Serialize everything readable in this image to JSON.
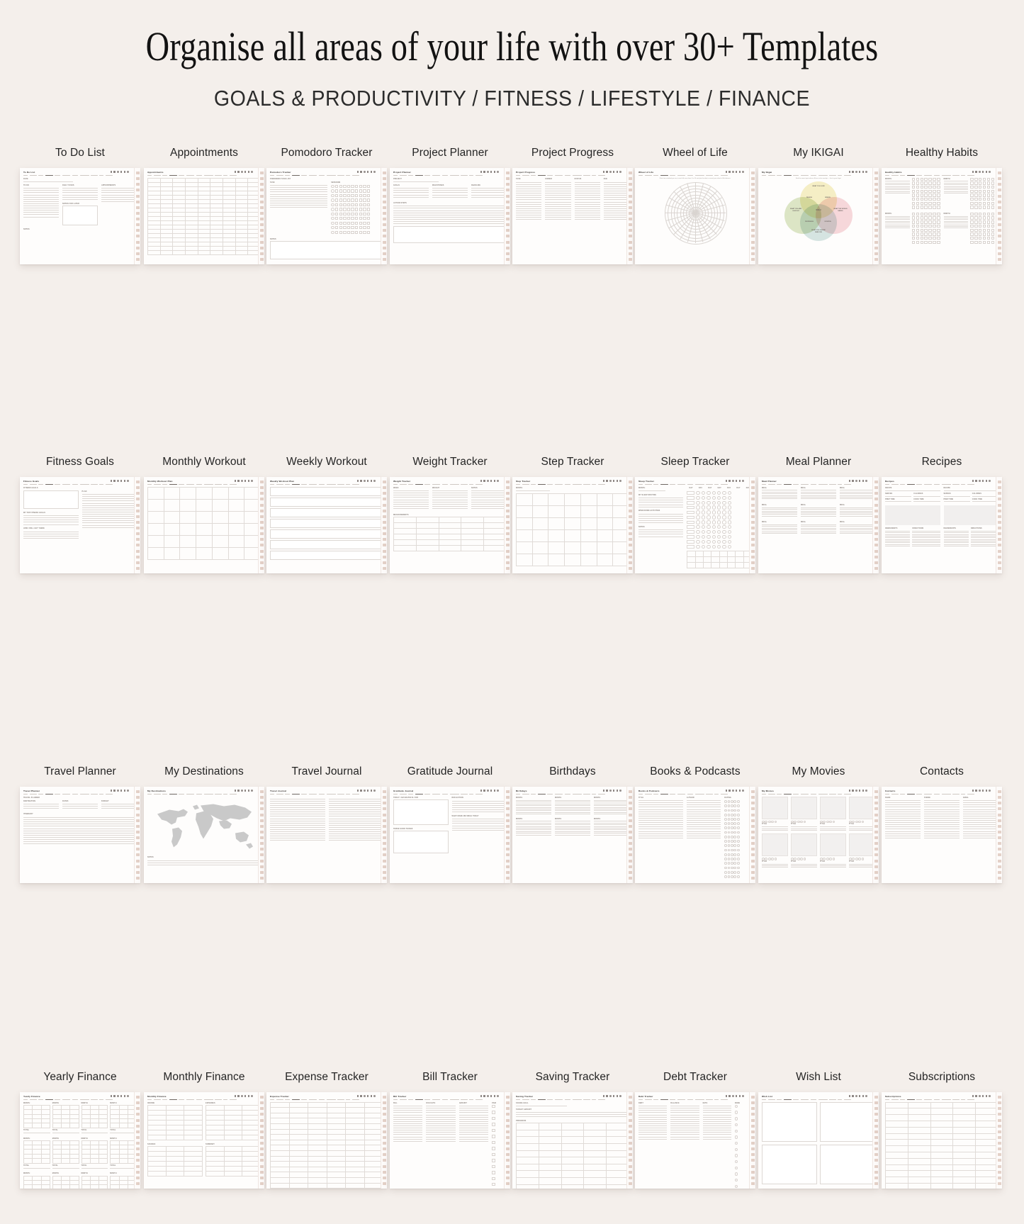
{
  "header": {
    "title": "Organise all areas of your life with over 30+ Templates",
    "subtitle": "GOALS & PRODUCTIVITY  /  FITNESS  /  LIFESTYLE  /  FINANCE"
  },
  "theme": {
    "background": "#f4efeb",
    "page": "#fefdfc",
    "rule": "#ddd8d4",
    "tab_marker": "#e3cfc5",
    "text": "#242424",
    "ikigai_top": "#f6f0c8",
    "ikigai_right": "#f7d9dd",
    "ikigai_bottom": "#d6e6e4",
    "ikigai_left": "#dde7c8",
    "map_land": "#c9c9c9"
  },
  "rows": [
    {
      "category": "GOALS & PRODUCTIVITY",
      "cards": [
        {
          "label": "To Do List",
          "page_title": "To Do List",
          "kind": "todo"
        },
        {
          "label": "Appointments",
          "page_title": "Appointments",
          "kind": "appointments"
        },
        {
          "label": "Pomodoro Tracker",
          "page_title": "Pomodoro Tracker",
          "kind": "pomodoro"
        },
        {
          "label": "Project Planner",
          "page_title": "Project Planner",
          "kind": "project-planner"
        },
        {
          "label": "Project Progress",
          "page_title": "Project Progress",
          "kind": "project-progress"
        },
        {
          "label": "Wheel of Life",
          "page_title": "Wheel of Life",
          "kind": "wheel",
          "note": "Rate how satisfied you are in each life area from 1 to 10 and join the dots to reveal your wheel of life balance."
        },
        {
          "label": "My IKIGAI",
          "page_title": "My Ikigai",
          "kind": "ikigai",
          "note": "Find the sweet spot where all four circles overlap — that is your ikigai.",
          "circles": [
            {
              "name": "WHAT YOU LOVE",
              "position": "top"
            },
            {
              "name": "WHAT THE WORLD NEEDS",
              "position": "right"
            },
            {
              "name": "WHAT YOU CAN BE PAID FOR",
              "position": "bottom"
            },
            {
              "name": "WHAT YOU ARE GOOD AT",
              "position": "left"
            }
          ],
          "center": "IKIGAI",
          "overlaps": [
            "PASSION",
            "MISSION",
            "PROFESSION",
            "VOCATION"
          ]
        },
        {
          "label": "Healthy Habits",
          "page_title": "Healthy Habits",
          "kind": "habits"
        }
      ]
    },
    {
      "category": "FITNESS",
      "cards": [
        {
          "label": "Fitness Goals",
          "page_title": "Fitness Goals",
          "kind": "fitness-goals"
        },
        {
          "label": "Monthly Workout",
          "page_title": "Monthly Workout Plan",
          "kind": "monthly-workout"
        },
        {
          "label": "Weekly Workout",
          "page_title": "Weekly Workout Plan",
          "kind": "weekly-workout"
        },
        {
          "label": "Weight Tracker",
          "page_title": "Weight Tracker",
          "kind": "weight"
        },
        {
          "label": "Step Tracker",
          "page_title": "Step Tracker",
          "kind": "steps"
        },
        {
          "label": "Sleep Tracker",
          "page_title": "Sleep Tracker",
          "kind": "sleep"
        },
        {
          "label": "Meal Planner",
          "page_title": "Meal Planner",
          "kind": "meal"
        },
        {
          "label": "Recipes",
          "page_title": "Recipes",
          "kind": "recipes"
        }
      ]
    },
    {
      "category": "LIFESTYLE",
      "cards": [
        {
          "label": "Travel Planner",
          "page_title": "Travel Planner",
          "kind": "travel-planner"
        },
        {
          "label": "My Destinations",
          "page_title": "My Destinations",
          "kind": "destinations"
        },
        {
          "label": "Travel Journal",
          "page_title": "Travel Journal",
          "kind": "travel-journal"
        },
        {
          "label": "Gratitude Journal",
          "page_title": "Gratitude Journal",
          "kind": "gratitude"
        },
        {
          "label": "Birthdays",
          "page_title": "Birthdays",
          "kind": "birthdays"
        },
        {
          "label": "Books & Podcasts",
          "page_title": "Books & Podcasts",
          "kind": "books"
        },
        {
          "label": "My Movies",
          "page_title": "My Movies",
          "kind": "movies"
        },
        {
          "label": "Contacts",
          "page_title": "Contacts",
          "kind": "contacts"
        }
      ]
    },
    {
      "category": "FINANCE",
      "cards": [
        {
          "label": "Yearly Finance",
          "page_title": "Yearly Finance",
          "kind": "yearly-finance"
        },
        {
          "label": "Monthly Finance",
          "page_title": "Monthly Finance",
          "kind": "monthly-finance"
        },
        {
          "label": "Expense Tracker",
          "page_title": "Expense Tracker",
          "kind": "expense"
        },
        {
          "label": "Bill Tracker",
          "page_title": "Bill Tracker",
          "kind": "bills"
        },
        {
          "label": "Saving Tracker",
          "page_title": "Saving Tracker",
          "kind": "saving"
        },
        {
          "label": "Debt Tracker",
          "page_title": "Debt Tracker",
          "kind": "debt"
        },
        {
          "label": "Wish List",
          "page_title": "Wish List",
          "kind": "wishlist"
        },
        {
          "label": "Subscriptions",
          "page_title": "Subscriptions",
          "kind": "subscriptions"
        }
      ]
    }
  ],
  "card_chrome": {
    "icon_count": 6,
    "tab_count": 16,
    "nav_item_count": 11
  }
}
